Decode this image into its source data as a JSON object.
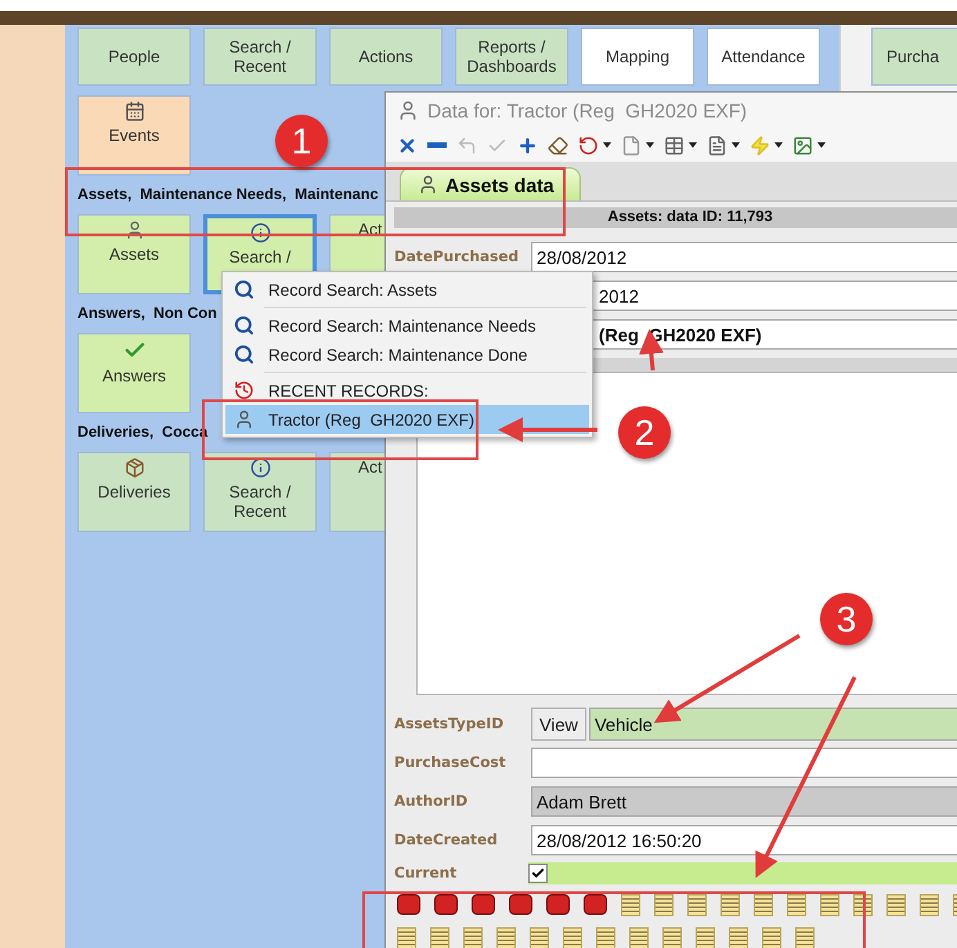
{
  "nav_buttons": [
    {
      "label": "People",
      "kind": "module"
    },
    {
      "label": "Search /\nRecent",
      "kind": "module"
    },
    {
      "label": "Actions",
      "kind": "module"
    },
    {
      "label": "Reports /\nDashboards",
      "kind": "module"
    },
    {
      "label": "Mapping",
      "kind": "tool"
    },
    {
      "label": "Attendance",
      "kind": "tool"
    }
  ],
  "side_button": {
    "label": "Purcha"
  },
  "events_button": {
    "label": "Events"
  },
  "sections": [
    {
      "title": "Assets,  Maintenance Needs,  Maintenanc",
      "buttons": [
        {
          "label": "Assets",
          "kind": "assets",
          "selected": false
        },
        {
          "label": "Search /",
          "kind": "search",
          "selected": true
        },
        {
          "label": "Act",
          "kind": "actions",
          "selected": false
        }
      ]
    },
    {
      "title": "Answers,  Non Con",
      "buttons": [
        {
          "label": "Answers",
          "kind": "answers",
          "selected": false
        }
      ]
    },
    {
      "title": "Deliveries,  Cocca",
      "buttons": [
        {
          "label": "Deliveries",
          "kind": "deliveries",
          "selected": false
        },
        {
          "label": "Search /\nRecent",
          "kind": "search",
          "selected": false
        },
        {
          "label": "Act",
          "kind": "actions",
          "selected": false
        }
      ]
    }
  ],
  "data_window": {
    "title": "Data for: Tractor (Reg  GH2020 EXF)",
    "toolbar": [
      {
        "kind": "close",
        "disabled": false,
        "dropdown": false
      },
      {
        "kind": "minus",
        "disabled": false,
        "dropdown": false
      },
      {
        "kind": "return",
        "disabled": true,
        "dropdown": false
      },
      {
        "kind": "confirm",
        "disabled": true,
        "dropdown": false
      },
      {
        "kind": "add",
        "disabled": false,
        "dropdown": false
      },
      {
        "kind": "eraser",
        "disabled": false,
        "dropdown": false
      },
      {
        "kind": "revert",
        "disabled": false,
        "dropdown": true
      },
      {
        "kind": "page",
        "disabled": false,
        "dropdown": true
      },
      {
        "kind": "grid",
        "disabled": false,
        "dropdown": true
      },
      {
        "kind": "form",
        "disabled": false,
        "dropdown": true
      },
      {
        "kind": "bolt",
        "disabled": false,
        "dropdown": true
      },
      {
        "kind": "picture",
        "disabled": false,
        "dropdown": true
      }
    ],
    "tabs": [
      {
        "label": "Assets data",
        "selected": true
      }
    ],
    "header": "Assets: data ID: 11,793",
    "top_fields": [
      {
        "kind": "text",
        "label": "DatePurchased",
        "value": "28/08/2012"
      },
      {
        "kind": "partial",
        "value": "2012"
      },
      {
        "kind": "partial_bold",
        "value": "(Reg  GH2020 EXF)"
      }
    ],
    "bottom_fields": [
      {
        "kind": "lookup",
        "label": "AssetsTypeID",
        "button": "View",
        "value": "Vehicle"
      },
      {
        "kind": "text",
        "label": "PurchaseCost"
      },
      {
        "kind": "readonly",
        "label": "AuthorID",
        "value": "Adam Brett"
      },
      {
        "kind": "text",
        "label": "DateCreated",
        "value": "28/08/2012 16:50:20"
      },
      {
        "kind": "checkbox",
        "label": "Current",
        "checked": true
      }
    ]
  },
  "menu": {
    "items": [
      {
        "kind": "search",
        "label": "Record Search: Assets",
        "selected": false
      },
      {
        "kind": "separator"
      },
      {
        "kind": "search",
        "label": "Record Search: Maintenance Needs",
        "selected": false
      },
      {
        "kind": "search",
        "label": "Record Search: Maintenance Done",
        "selected": false
      },
      {
        "kind": "separator"
      },
      {
        "kind": "header",
        "label": "RECENT RECORDS:",
        "selected": false
      },
      {
        "kind": "record",
        "label": "Tractor (Reg  GH2020 EXF)",
        "selected": true
      }
    ]
  },
  "callouts": [
    {
      "number": "1"
    },
    {
      "number": "2"
    },
    {
      "number": "3"
    }
  ]
}
